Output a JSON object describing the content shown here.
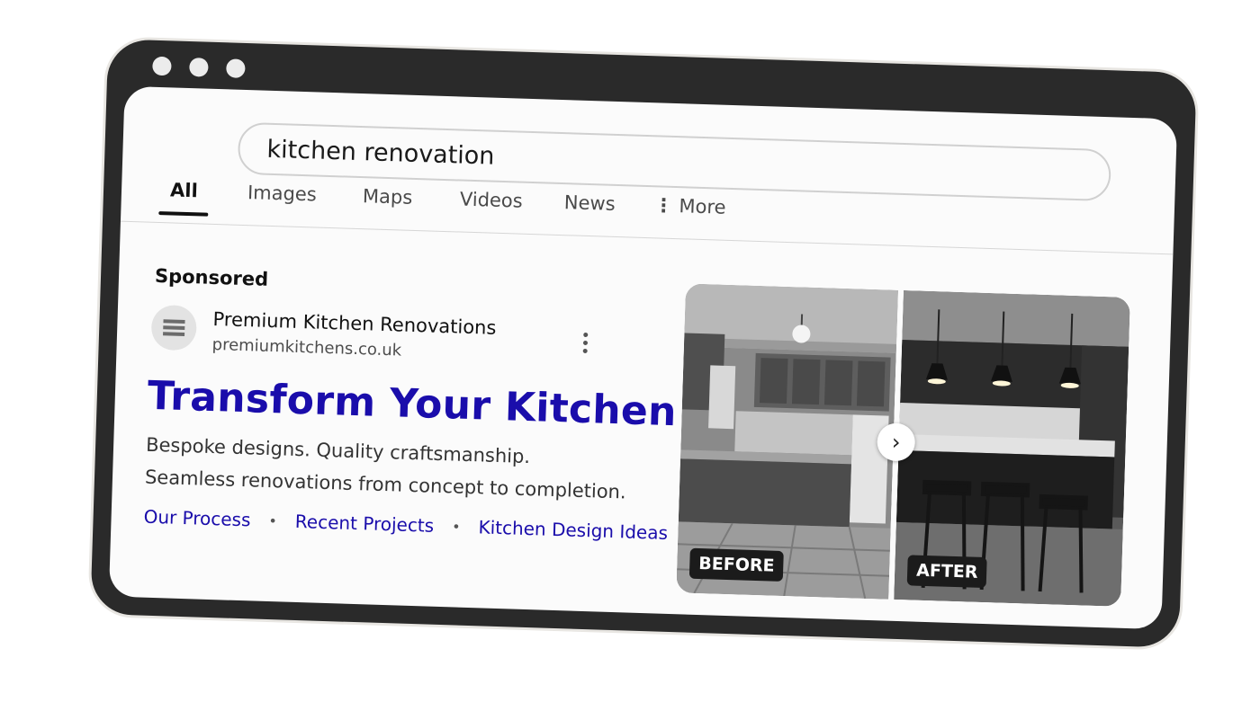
{
  "search": {
    "query": "kitchen renovation"
  },
  "tabs": [
    {
      "label": "All",
      "active": true
    },
    {
      "label": "Images"
    },
    {
      "label": "Maps"
    },
    {
      "label": "Videos"
    },
    {
      "label": "News"
    },
    {
      "label": "More",
      "icon": "vertical-dots-icon"
    }
  ],
  "ad": {
    "sponsored_label": "Sponsored",
    "advertiser_name": "Premium Kitchen Renovations",
    "advertiser_url": "premiumkitchens.co.uk",
    "headline": "Transform Your Kitchen",
    "description_lines": [
      "Bespoke designs. Quality craftsmanship.",
      "Seamless renovations from concept to completion."
    ],
    "sitelinks": [
      "Our Process",
      "Recent Projects",
      "Kitchen Design Ideas"
    ],
    "images": {
      "before_label": "BEFORE",
      "after_label": "AFTER",
      "next_icon": "chevron-right-icon"
    }
  },
  "colors": {
    "link": "#1a0dab",
    "frame": "#2a2a2a",
    "screen": "#fbfbfb"
  }
}
